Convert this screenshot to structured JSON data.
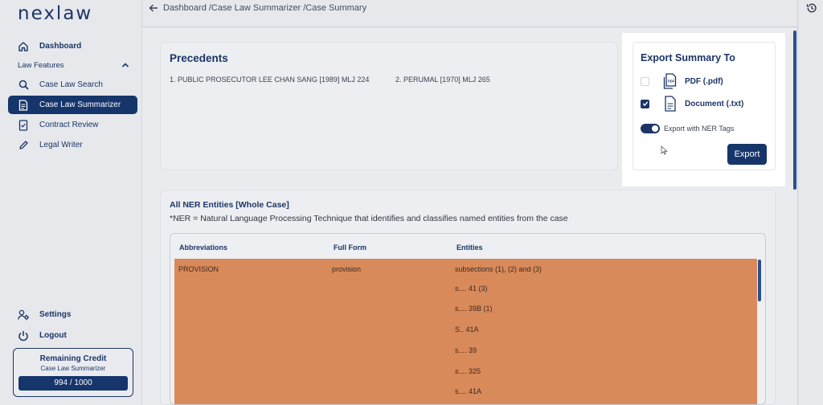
{
  "app": {
    "logo": "nexlaw"
  },
  "sidebar": {
    "dashboard": "Dashboard",
    "section": "Law Features",
    "items": [
      {
        "label": "Case Law Search",
        "icon": "search-icon"
      },
      {
        "label": "Case Law Summarizer",
        "icon": "document-icon",
        "active": true
      },
      {
        "label": "Contract Review",
        "icon": "contract-icon"
      },
      {
        "label": "Legal Writer",
        "icon": "pen-icon"
      }
    ],
    "settings": "Settings",
    "logout": "Logout",
    "credit": {
      "title": "Remaining Credit",
      "subtitle": "Case Law Summarizer",
      "value": "994 / 1000"
    }
  },
  "breadcrumb": "Dashboard /Case Law Summarizer /Case Summary",
  "precedents": {
    "title": "Precedents",
    "items": [
      "1. PUBLIC PROSECUTOR LEE CHAN SANG [1989] MLJ 224",
      "2. PERUMAL [1970] MLJ 265"
    ]
  },
  "ner": {
    "title": "All NER Entities [Whole Case]",
    "note": "*NER = Natural Language Processing Technique that identifies and classifies named entities from the case",
    "columns": [
      "Abbreviations",
      "Full Form",
      "Entities"
    ],
    "row": {
      "abbreviation": "PROVISION",
      "full_form": "provision"
    },
    "entities": [
      "subsections (1), (2) and (3)",
      "s.... 41 (3)",
      "s.... 39B (1)",
      "S.. 41A",
      "s.... 39",
      "s.... 325",
      "s.... 41A"
    ]
  },
  "export": {
    "title": "Export Summary To",
    "options": [
      {
        "label": "PDF (.pdf)",
        "checked": false,
        "icon": "pdf-file-icon"
      },
      {
        "label": "Document (.txt)",
        "checked": true,
        "icon": "document-file-icon"
      }
    ],
    "toggle_label": "Export with NER Tags",
    "toggle_on": true,
    "button": "Export"
  },
  "colors": {
    "brand": "#16356b",
    "table_highlight": "#d98a5a"
  }
}
